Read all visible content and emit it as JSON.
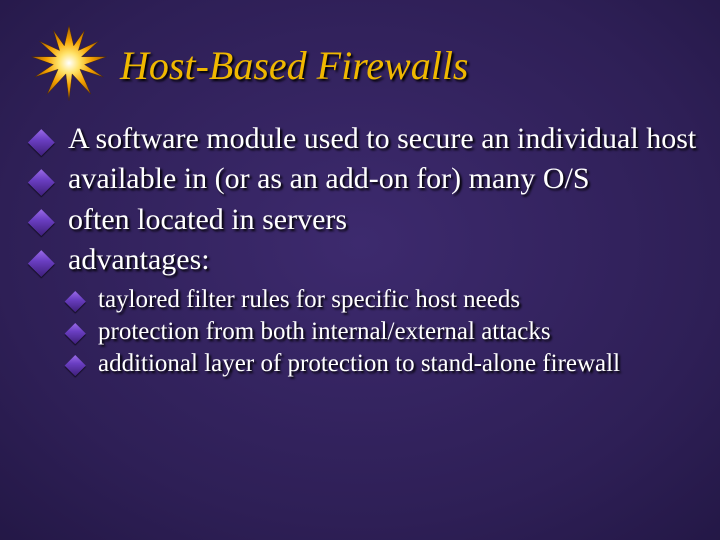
{
  "title": "Host-Based Firewalls",
  "bullets": {
    "b0": "A software module used to secure an individual host",
    "b1": "available in (or as an add-on for) many O/S",
    "b2": "often located in servers",
    "b3": "advantages:"
  },
  "sub_bullets": {
    "s0": "taylored filter rules for specific host needs",
    "s1": "protection from both internal/external attacks",
    "s2": "additional layer of protection to stand-alone firewall"
  }
}
